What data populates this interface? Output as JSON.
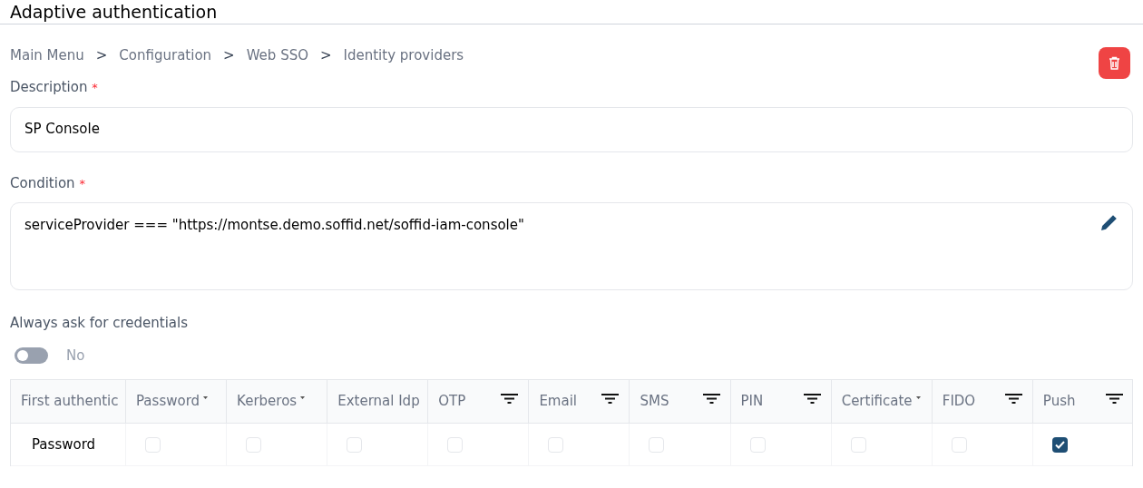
{
  "title": "Adaptive authentication",
  "breadcrumb": [
    {
      "label": "Main Menu",
      "separator": ">"
    },
    {
      "label": "Configuration",
      "separator": ">"
    },
    {
      "label": "Web SSO",
      "separator": ">"
    },
    {
      "label": "Identity providers"
    }
  ],
  "description": {
    "label": "Description",
    "required": "*",
    "value": "SP Console"
  },
  "condition": {
    "label": "Condition",
    "required": "*",
    "value": "serviceProvider === \"https://montse.demo.soffid.net/soffid-iam-console\""
  },
  "always_ask": {
    "label": "Always ask for credentials",
    "on": false,
    "value_label": "No"
  },
  "table": {
    "columns": [
      {
        "label": "First authentic",
        "kind": "plain"
      },
      {
        "label": "Password",
        "kind": "sortable"
      },
      {
        "label": "Kerberos",
        "kind": "sortable"
      },
      {
        "label": "External Idp",
        "kind": "plain"
      },
      {
        "label": "OTP",
        "kind": "filterable"
      },
      {
        "label": "Email",
        "kind": "filterable"
      },
      {
        "label": "SMS",
        "kind": "filterable"
      },
      {
        "label": "PIN",
        "kind": "filterable"
      },
      {
        "label": "Certificate",
        "kind": "sortable"
      },
      {
        "label": "FIDO",
        "kind": "filterable"
      },
      {
        "label": "Push",
        "kind": "filterable"
      }
    ],
    "rows": [
      {
        "name": "Password",
        "checks": [
          false,
          false,
          false,
          false,
          false,
          false,
          false,
          false,
          false,
          true
        ]
      }
    ]
  }
}
